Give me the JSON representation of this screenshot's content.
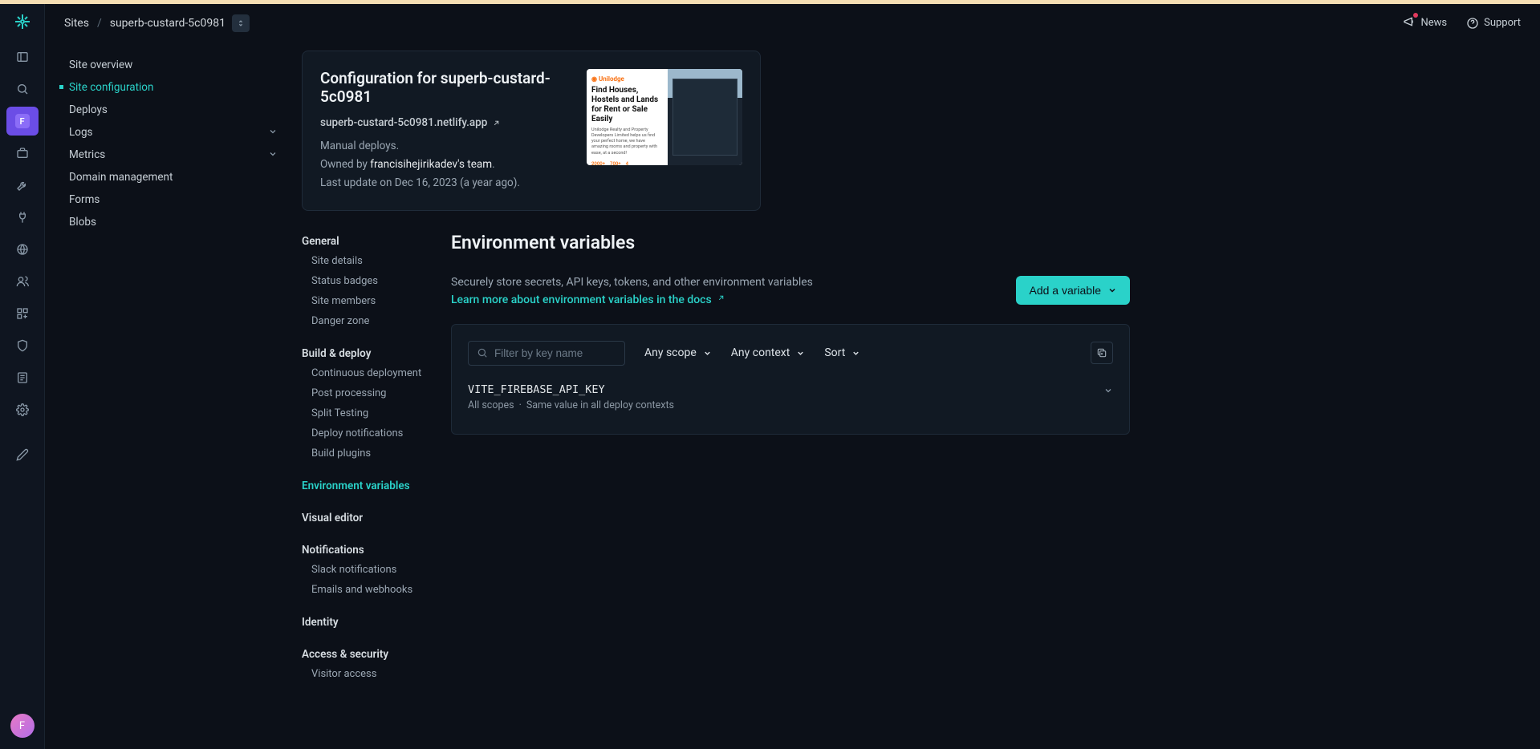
{
  "breadcrumb": {
    "root": "Sites",
    "site": "superb-custard-5c0981"
  },
  "topbar_right": {
    "news": "News",
    "support": "Support"
  },
  "rail_avatar": "F",
  "site_nav": {
    "items": [
      {
        "label": "Site overview",
        "active": false
      },
      {
        "label": "Site configuration",
        "active": true
      },
      {
        "label": "Deploys",
        "active": false
      },
      {
        "label": "Logs",
        "active": false,
        "expandable": true
      },
      {
        "label": "Metrics",
        "active": false,
        "expandable": true
      },
      {
        "label": "Domain management",
        "active": false
      },
      {
        "label": "Forms",
        "active": false
      },
      {
        "label": "Blobs",
        "active": false
      }
    ]
  },
  "card": {
    "title": "Configuration for superb-custard-5c0981",
    "url": "superb-custard-5c0981.netlify.app",
    "deploy_method": "Manual deploys.",
    "owned_by_prefix": "Owned by ",
    "team": "francisihejirikadev's team",
    "last_update": "Last update on Dec 16, 2023 (a year ago).",
    "thumb": {
      "brand": "Unilodge",
      "headline": "Find Houses, Hostels and Lands for Rent or Sale Easily",
      "sub": "Unilodge Realty and Property Developers Limited helps us find your perfect home, we have amazing rooms and property with ease, at a second!",
      "stats": [
        "2000+",
        "700+",
        "4"
      ]
    }
  },
  "settings_nav": {
    "groups": [
      {
        "title": "General",
        "items": [
          "Site details",
          "Status badges",
          "Site members",
          "Danger zone"
        ],
        "active": false
      },
      {
        "title": "Build & deploy",
        "items": [
          "Continuous deployment",
          "Post processing",
          "Split Testing",
          "Deploy notifications",
          "Build plugins"
        ],
        "active": false
      },
      {
        "title": "Environment variables",
        "items": [],
        "active": true
      },
      {
        "title": "Visual editor",
        "items": [],
        "active": false
      },
      {
        "title": "Notifications",
        "items": [
          "Slack notifications",
          "Emails and webhooks"
        ],
        "active": false
      },
      {
        "title": "Identity",
        "items": [],
        "active": false
      },
      {
        "title": "Access & security",
        "items": [
          "Visitor access"
        ],
        "active": false
      }
    ]
  },
  "env": {
    "title": "Environment variables",
    "desc": "Securely store secrets, API keys, tokens, and other environment variables",
    "learn_more": "Learn more about environment variables in the docs",
    "add_btn": "Add a variable",
    "filter_placeholder": "Filter by key name",
    "scope_filter": "Any scope",
    "context_filter": "Any context",
    "sort_label": "Sort",
    "vars": [
      {
        "key": "VITE_FIREBASE_API_KEY",
        "scopes": "All scopes",
        "context": "Same value in all deploy contexts"
      }
    ]
  }
}
